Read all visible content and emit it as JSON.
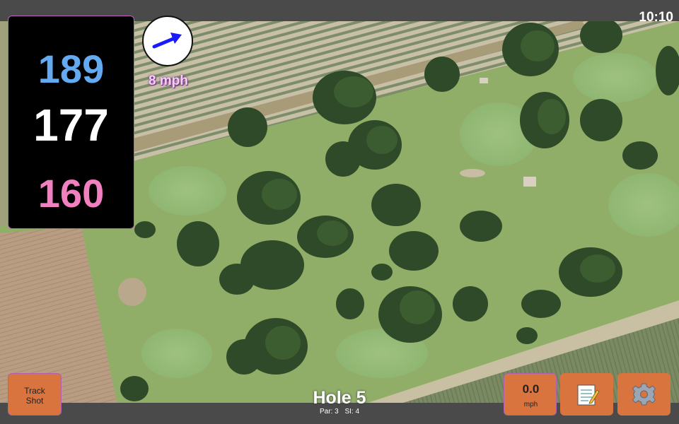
{
  "status_bar": {
    "time": "10:10"
  },
  "yardages": {
    "back": "189",
    "middle": "177",
    "front": "160"
  },
  "wind": {
    "speed_label": "8 mph",
    "direction_icon": "arrow-icon"
  },
  "hole": {
    "title": "Hole 5",
    "par_label": "Par: 3",
    "si_label": "SI: 4"
  },
  "buttons": {
    "track_shot_line1": "Track",
    "track_shot_line2": "Shot",
    "speed_value": "0.0",
    "speed_unit": "mph",
    "notes_icon": "notes-icon",
    "settings_icon": "gear-icon"
  },
  "colors": {
    "back_yard": "#64aaf0",
    "middle_yard": "#ffffff",
    "front_yard": "#f080c0",
    "button": "#d9743f",
    "bar": "#4a4a4a"
  }
}
